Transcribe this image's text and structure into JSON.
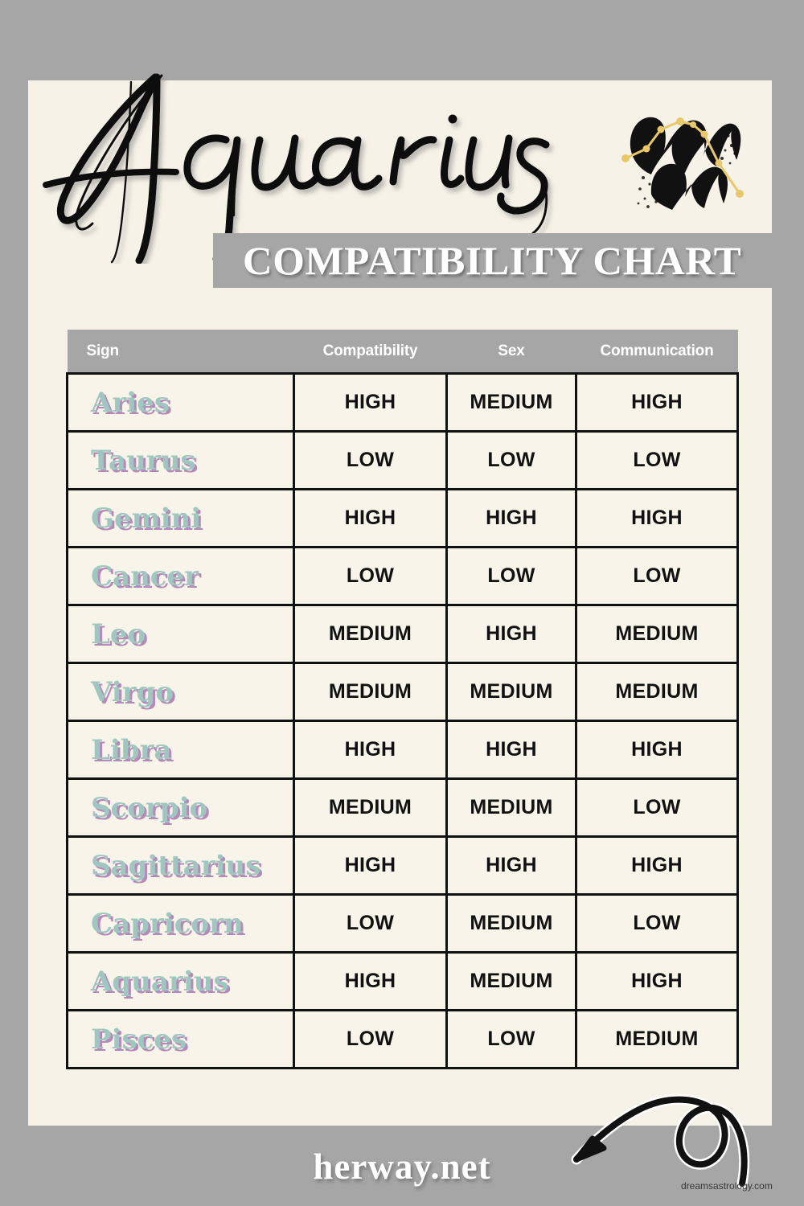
{
  "theme": {
    "page_bg": "#a6a6a6",
    "card_bg": "#f7f2e7",
    "banner_bg": "#a6a6a6",
    "header_bg": "#a6a6a6",
    "cell_bg": "#f9f4ea",
    "grid_line": "#111111",
    "sign_text": "#9fc7c0",
    "sign_shadow": "#b58ab8",
    "accent_gold": "#e8c86a",
    "ink_black": "#111111",
    "white": "#ffffff"
  },
  "header": {
    "script_title": "Aquarius",
    "subtitle": "COMPATIBILITY CHART",
    "zodiac_symbol_name": "aquarius-glyph"
  },
  "table": {
    "columns": [
      "Sign",
      "Compatibility",
      "Sex",
      "Communication"
    ],
    "rows": [
      {
        "sign": "Aries",
        "compatibility": "HIGH",
        "sex": "MEDIUM",
        "communication": "HIGH"
      },
      {
        "sign": "Taurus",
        "compatibility": "LOW",
        "sex": "LOW",
        "communication": "LOW"
      },
      {
        "sign": "Gemini",
        "compatibility": "HIGH",
        "sex": "HIGH",
        "communication": "HIGH"
      },
      {
        "sign": "Cancer",
        "compatibility": "LOW",
        "sex": "LOW",
        "communication": "LOW"
      },
      {
        "sign": "Leo",
        "compatibility": "MEDIUM",
        "sex": "HIGH",
        "communication": "MEDIUM"
      },
      {
        "sign": "Virgo",
        "compatibility": "MEDIUM",
        "sex": "MEDIUM",
        "communication": "MEDIUM"
      },
      {
        "sign": "Libra",
        "compatibility": "HIGH",
        "sex": "HIGH",
        "communication": "HIGH"
      },
      {
        "sign": "Scorpio",
        "compatibility": "MEDIUM",
        "sex": "MEDIUM",
        "communication": "LOW"
      },
      {
        "sign": "Sagittarius",
        "compatibility": "HIGH",
        "sex": "HIGH",
        "communication": "HIGH"
      },
      {
        "sign": "Capricorn",
        "compatibility": "LOW",
        "sex": "MEDIUM",
        "communication": "LOW"
      },
      {
        "sign": "Aquarius",
        "compatibility": "HIGH",
        "sex": "MEDIUM",
        "communication": "HIGH"
      },
      {
        "sign": "Pisces",
        "compatibility": "LOW",
        "sex": "LOW",
        "communication": "MEDIUM"
      }
    ]
  },
  "footer": {
    "site_name": "herway.net",
    "watermark": "dreamsastrology.com",
    "arrow_name": "curly-arrow-icon"
  }
}
